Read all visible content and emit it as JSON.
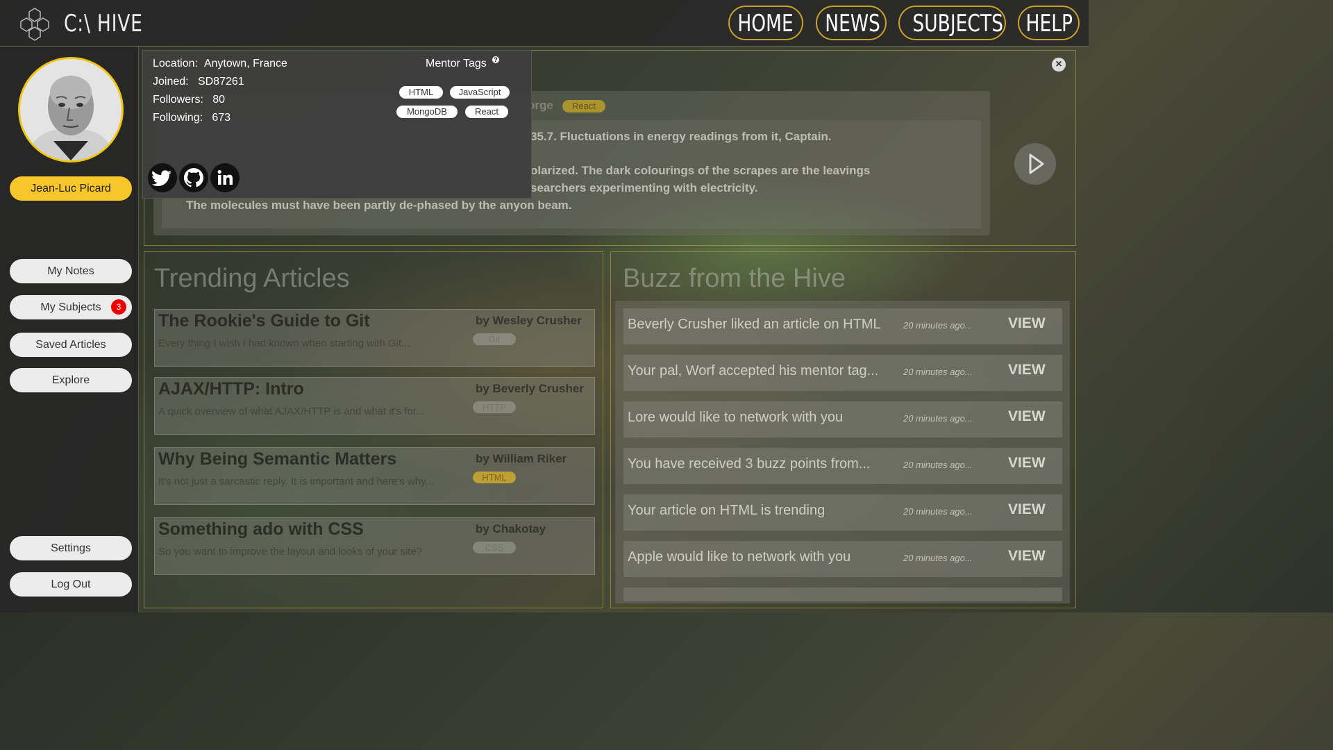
{
  "header": {
    "brand": "C:\\ HIVE",
    "nav": [
      "HOME",
      "NEWS",
      "SUBJECTS",
      "HELP"
    ]
  },
  "sidebar": {
    "user_name": "Jean-Luc Picard",
    "items": [
      {
        "label": "My Notes"
      },
      {
        "label": "My Subjects",
        "badge": "3"
      },
      {
        "label": "Saved Articles"
      },
      {
        "label": "Explore"
      }
    ],
    "bottom": [
      {
        "label": "Settings"
      },
      {
        "label": "Log Out"
      }
    ]
  },
  "profile": {
    "location_label": "Location:",
    "location": "Anytown, France",
    "joined_label": "Joined:",
    "joined": "SD87261",
    "followers_label": "Followers:",
    "followers": "80",
    "following_label": "Following:",
    "following": "673",
    "mentor_title": "Mentor Tags",
    "mentor_help": "?",
    "tags": [
      "HTML",
      "JavaScript",
      "MongoDB",
      "React"
    ],
    "social_icons": [
      "twitter-icon",
      "github-icon",
      "linkedin-icon"
    ]
  },
  "welcome": {
    "tag": "React",
    "header_fragment": "orge",
    "lines": [
      "35.7. Fluctuations in energy readings from it, Captain.",
      "olarized. The dark colourings of the scrapes are the leavings",
      "searchers experimenting with electricity.",
      "The molecules must have been partly de-phased by the anyon beam."
    ]
  },
  "trending": {
    "title": "Trending Articles",
    "articles": [
      {
        "title": "The Rookie's Guide to Git",
        "desc": "Every thing I wish I had known when starting with Git...",
        "author": "by Wesley Crusher",
        "tag": "Git"
      },
      {
        "title": "AJAX/HTTP: Intro",
        "desc": "A quick overview of what AJAX/HTTP is and what it's for...",
        "author": "by Beverly Crusher",
        "tag": "HTTP"
      },
      {
        "title": "Why Being Semantic Matters",
        "desc": "It's not just a sarcastic reply. It is important and here's why...",
        "author": "by William Riker",
        "tag": "HTML"
      },
      {
        "title": "Something ado with CSS",
        "desc": "So you want to improve the layout and looks of your site?",
        "author": "by Chakotay",
        "tag": "CSS"
      }
    ]
  },
  "buzz": {
    "title": "Buzz from the Hive",
    "items": [
      {
        "text": "Beverly Crusher liked an article on HTML",
        "time": "20 minutes ago...",
        "action": "VIEW"
      },
      {
        "text": "Your pal, Worf accepted his mentor tag...",
        "time": "20 minutes ago...",
        "action": "VIEW"
      },
      {
        "text": "Lore would like to network with you",
        "time": "20 minutes ago...",
        "action": "VIEW"
      },
      {
        "text": "You have received 3 buzz points from...",
        "time": "20 minutes ago...",
        "action": "VIEW"
      },
      {
        "text": "Your article on HTML is trending",
        "time": "20 minutes ago...",
        "action": "VIEW"
      },
      {
        "text": "Apple would like to network with you",
        "time": "20 minutes ago...",
        "action": "VIEW"
      }
    ]
  },
  "colors": {
    "accent": "#f8c52a",
    "badge": "#e00000",
    "border": "#c9a227"
  }
}
